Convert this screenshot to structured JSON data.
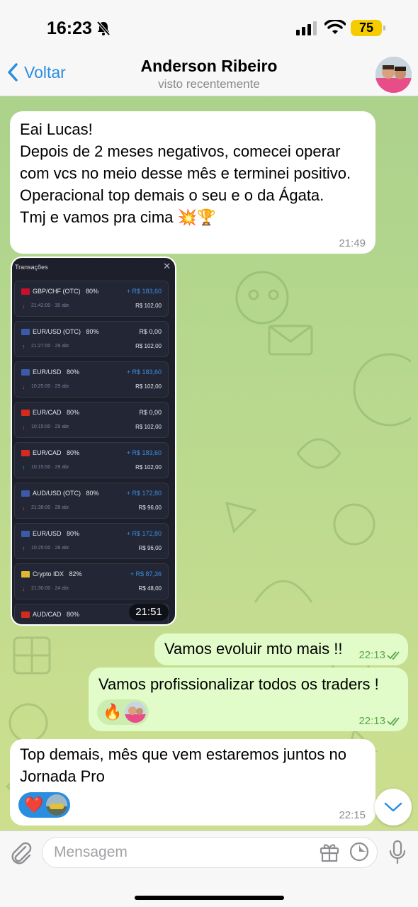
{
  "status_bar": {
    "time": "16:23",
    "battery": "75"
  },
  "header": {
    "back_label": "Voltar",
    "name": "Anderson Ribeiro",
    "status": "visto recentemente"
  },
  "messages": [
    {
      "direction": "in",
      "text": "Eai Lucas!\nDepois de 2 meses negativos, comecei operar com vcs no meio desse mês e terminei positivo. Operacional top demais o seu e o da Ágata.\nTmj e vamos pra cima 💥🏆",
      "time": "21:49"
    },
    {
      "direction": "in",
      "type": "image",
      "time": "21:51"
    },
    {
      "direction": "out",
      "text": "Vamos evoluir mto mais !!",
      "time": "22:13",
      "read": true
    },
    {
      "direction": "out",
      "text": "Vamos profissionalizar todos os traders !",
      "time": "22:13",
      "read": true,
      "reaction": "🔥"
    },
    {
      "direction": "in",
      "text": "Top demais, mês que vem estaremos juntos no Jornada Pro",
      "time": "22:15",
      "reaction": "❤️"
    }
  ],
  "screenshot": {
    "title": "Transações",
    "transactions": [
      {
        "pair": "GBP/CHF (OTC)",
        "pct": "80%",
        "amount": "+ R$ 183,60",
        "win": true,
        "date": "21:42:00 · 30 abr.",
        "stake": "R$ 102,00",
        "direction": "down",
        "flag": "#c8102e"
      },
      {
        "pair": "EUR/USD (OTC)",
        "pct": "80%",
        "amount": "R$ 0,00",
        "win": false,
        "date": "21:27:00 · 29 abr.",
        "stake": "R$ 102,00",
        "direction": "up",
        "flag": "#3c5aa8"
      },
      {
        "pair": "EUR/USD",
        "pct": "80%",
        "amount": "+ R$ 183,60",
        "win": true,
        "date": "10:25:00 · 29 abr.",
        "stake": "R$ 102,00",
        "direction": "down",
        "flag": "#3c5aa8"
      },
      {
        "pair": "EUR/CAD",
        "pct": "80%",
        "amount": "R$ 0,00",
        "win": false,
        "date": "10:15:00 · 29 abr.",
        "stake": "R$ 102,00",
        "direction": "down",
        "flag": "#d52b1e"
      },
      {
        "pair": "EUR/CAD",
        "pct": "80%",
        "amount": "+ R$ 183,60",
        "win": true,
        "date": "10:15:00 · 29 abr.",
        "stake": "R$ 102,00",
        "direction": "up",
        "flag": "#d52b1e"
      },
      {
        "pair": "AUD/USD (OTC)",
        "pct": "80%",
        "amount": "+ R$ 172,80",
        "win": true,
        "date": "21:38:00 · 28 abr.",
        "stake": "R$ 96,00",
        "direction": "down",
        "flag": "#3c5aa8"
      },
      {
        "pair": "EUR/USD",
        "pct": "80%",
        "amount": "+ R$ 172,80",
        "win": true,
        "date": "10:25:00 · 28 abr.",
        "stake": "R$ 96,00",
        "direction": "up",
        "flag": "#3c5aa8"
      },
      {
        "pair": "Crypto IDX",
        "pct": "82%",
        "amount": "+ R$ 87,36",
        "win": true,
        "date": "21:30:00 · 24 abr.",
        "stake": "R$ 48,00",
        "direction": "down",
        "flag": "#e0b830"
      },
      {
        "pair": "AUD/CAD",
        "pct": "80%",
        "amount": "",
        "win": true,
        "date": "",
        "stake": "",
        "direction": "down",
        "flag": "#d52b1e"
      }
    ]
  },
  "input": {
    "placeholder": "Mensagem"
  },
  "colors": {
    "accent": "#2a8ee0",
    "win": "#3b8fe0",
    "loss_arrow": "#e0473a",
    "up_arrow": "#37b24d",
    "outgoing_bubble": "#e1fcc9"
  }
}
